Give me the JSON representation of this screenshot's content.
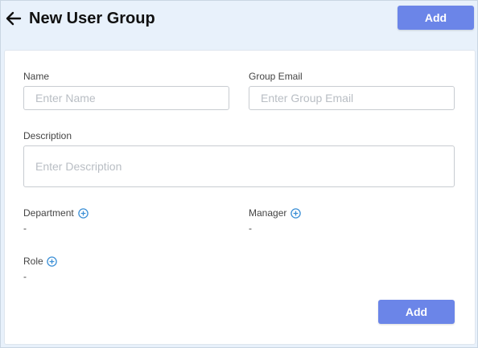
{
  "header": {
    "title": "New User Group",
    "add_label": "Add"
  },
  "form": {
    "name": {
      "label": "Name",
      "placeholder": "Enter Name"
    },
    "group_email": {
      "label": "Group Email",
      "placeholder": "Enter Group Email"
    },
    "description": {
      "label": "Description",
      "placeholder": "Enter Description"
    },
    "department": {
      "label": "Department",
      "value": "-"
    },
    "manager": {
      "label": "Manager",
      "value": "-"
    },
    "role": {
      "label": "Role",
      "value": "-"
    },
    "add_label": "Add"
  },
  "icons": {
    "back": "arrow-left-icon",
    "add_circle": "plus-circle-icon"
  },
  "colors": {
    "accent": "#6b85e8",
    "icon_blue": "#3b8fd6",
    "header_bg": "#e8f1fb"
  }
}
